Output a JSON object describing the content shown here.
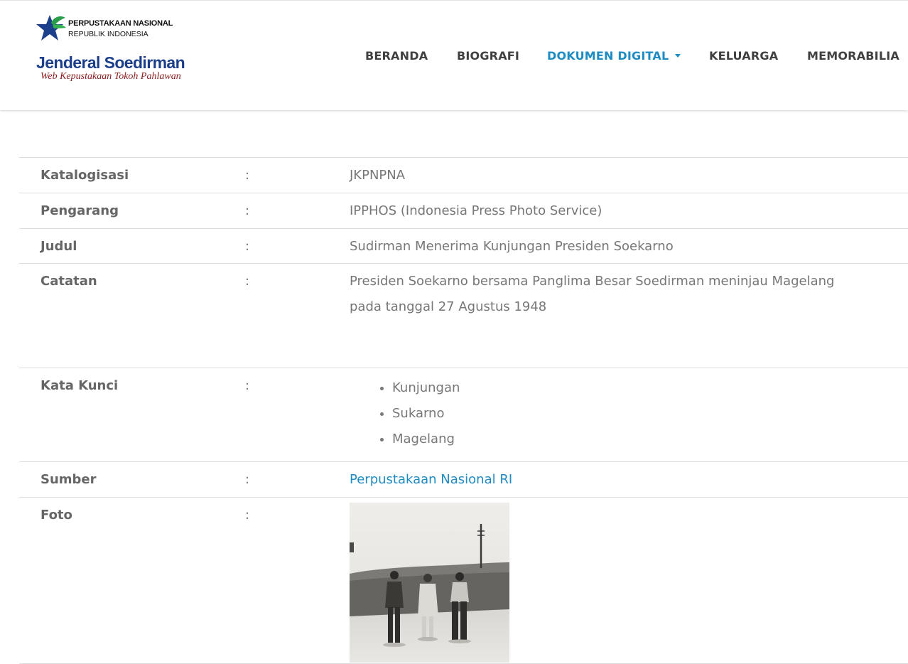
{
  "logo": {
    "org_line1": "PERPUSTAKAAN NASIONAL",
    "org_line2": "REPUBLIK INDONESIA",
    "title": "Jenderal Soedirman",
    "tagline": "Web Kepustakaan Tokoh Pahlawan",
    "icon": "star-logo-icon",
    "colors": {
      "star_blue": "#1c3f8c",
      "leaf_green": "#2a9d4a",
      "title_blue": "#1c3f8c",
      "tagline_red": "#8b1b1b"
    }
  },
  "nav": {
    "items": [
      {
        "label": "BERANDA"
      },
      {
        "label": "BIOGRAFI"
      },
      {
        "label": "DOKUMEN DIGITAL",
        "active": true,
        "icon": "caret-down-icon"
      },
      {
        "label": "KELUARGA"
      },
      {
        "label": "MEMORABILIA"
      }
    ],
    "active_color": "#1e8bc3",
    "text_color": "#404040"
  },
  "detail": {
    "separator": ":",
    "katalogisasi": {
      "label": "Katalogisasi",
      "value": "JKPNPNA"
    },
    "pengarang": {
      "label": "Pengarang",
      "value": "IPPHOS (Indonesia Press Photo Service)"
    },
    "judul": {
      "label": "Judul",
      "value": "Sudirman Menerima Kunjungan Presiden Soekarno"
    },
    "catatan": {
      "label": "Catatan",
      "value_line1": "Presiden Soekarno bersama Panglima Besar Soedirman meninjau Magelang",
      "value_line2": "pada tanggal 27 Agustus 1948"
    },
    "kata_kunci": {
      "label": "Kata Kunci",
      "items": [
        "Kunjungan",
        "Sukarno",
        "Magelang"
      ]
    },
    "sumber": {
      "label": "Sumber",
      "value": "Perpustakaan Nasional RI",
      "link_color": "#1e8bc3"
    },
    "foto": {
      "label": "Foto"
    }
  }
}
